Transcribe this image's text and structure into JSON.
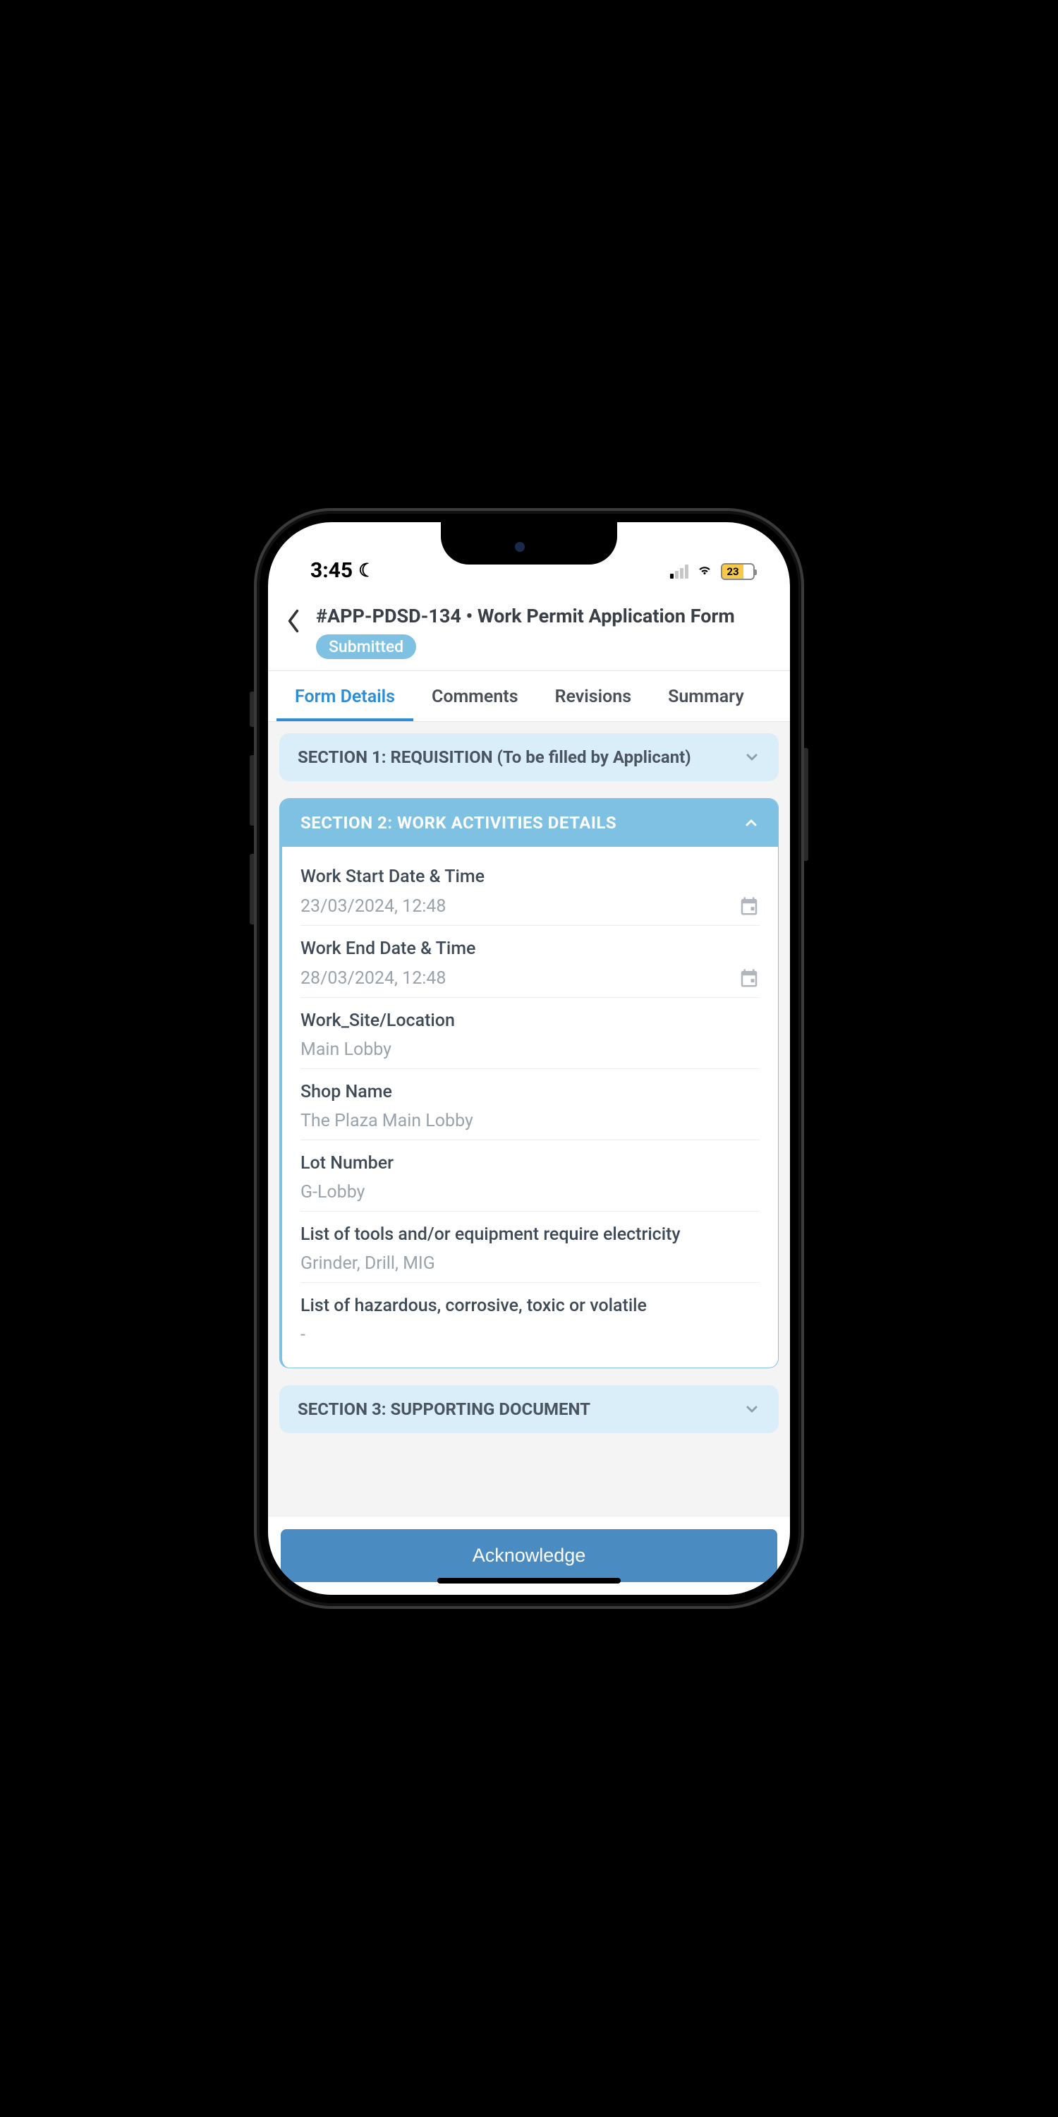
{
  "statusBar": {
    "time": "3:45",
    "batteryLevel": "23"
  },
  "header": {
    "title": "#APP-PDSD-134 • Work Permit Application Form",
    "statusBadge": "Submitted"
  },
  "tabs": [
    {
      "label": "Form Details"
    },
    {
      "label": "Comments"
    },
    {
      "label": "Revisions"
    },
    {
      "label": "Summary"
    }
  ],
  "sections": {
    "s1": {
      "title": "SECTION 1: REQUISITION (To be filled by Applicant)"
    },
    "s2": {
      "title": "SECTION 2: WORK ACTIVITIES DETAILS",
      "fields": {
        "workStart": {
          "label": "Work Start Date & Time",
          "value": "23/03/2024, 12:48"
        },
        "workEnd": {
          "label": "Work End Date & Time",
          "value": "28/03/2024, 12:48"
        },
        "location": {
          "label": "Work_Site/Location",
          "value": "Main Lobby"
        },
        "shop": {
          "label": "Shop Name",
          "value": "The Plaza Main Lobby"
        },
        "lot": {
          "label": "Lot Number",
          "value": "G-Lobby"
        },
        "tools": {
          "label": "List of tools and/or equipment require electricity",
          "value": "Grinder, Drill, MIG"
        },
        "hazardous": {
          "label": "List of hazardous, corrosive, toxic or volatile",
          "value": "-"
        }
      }
    },
    "s3": {
      "title": "SECTION 3: SUPPORTING DOCUMENT"
    }
  },
  "footer": {
    "ackLabel": "Acknowledge"
  }
}
